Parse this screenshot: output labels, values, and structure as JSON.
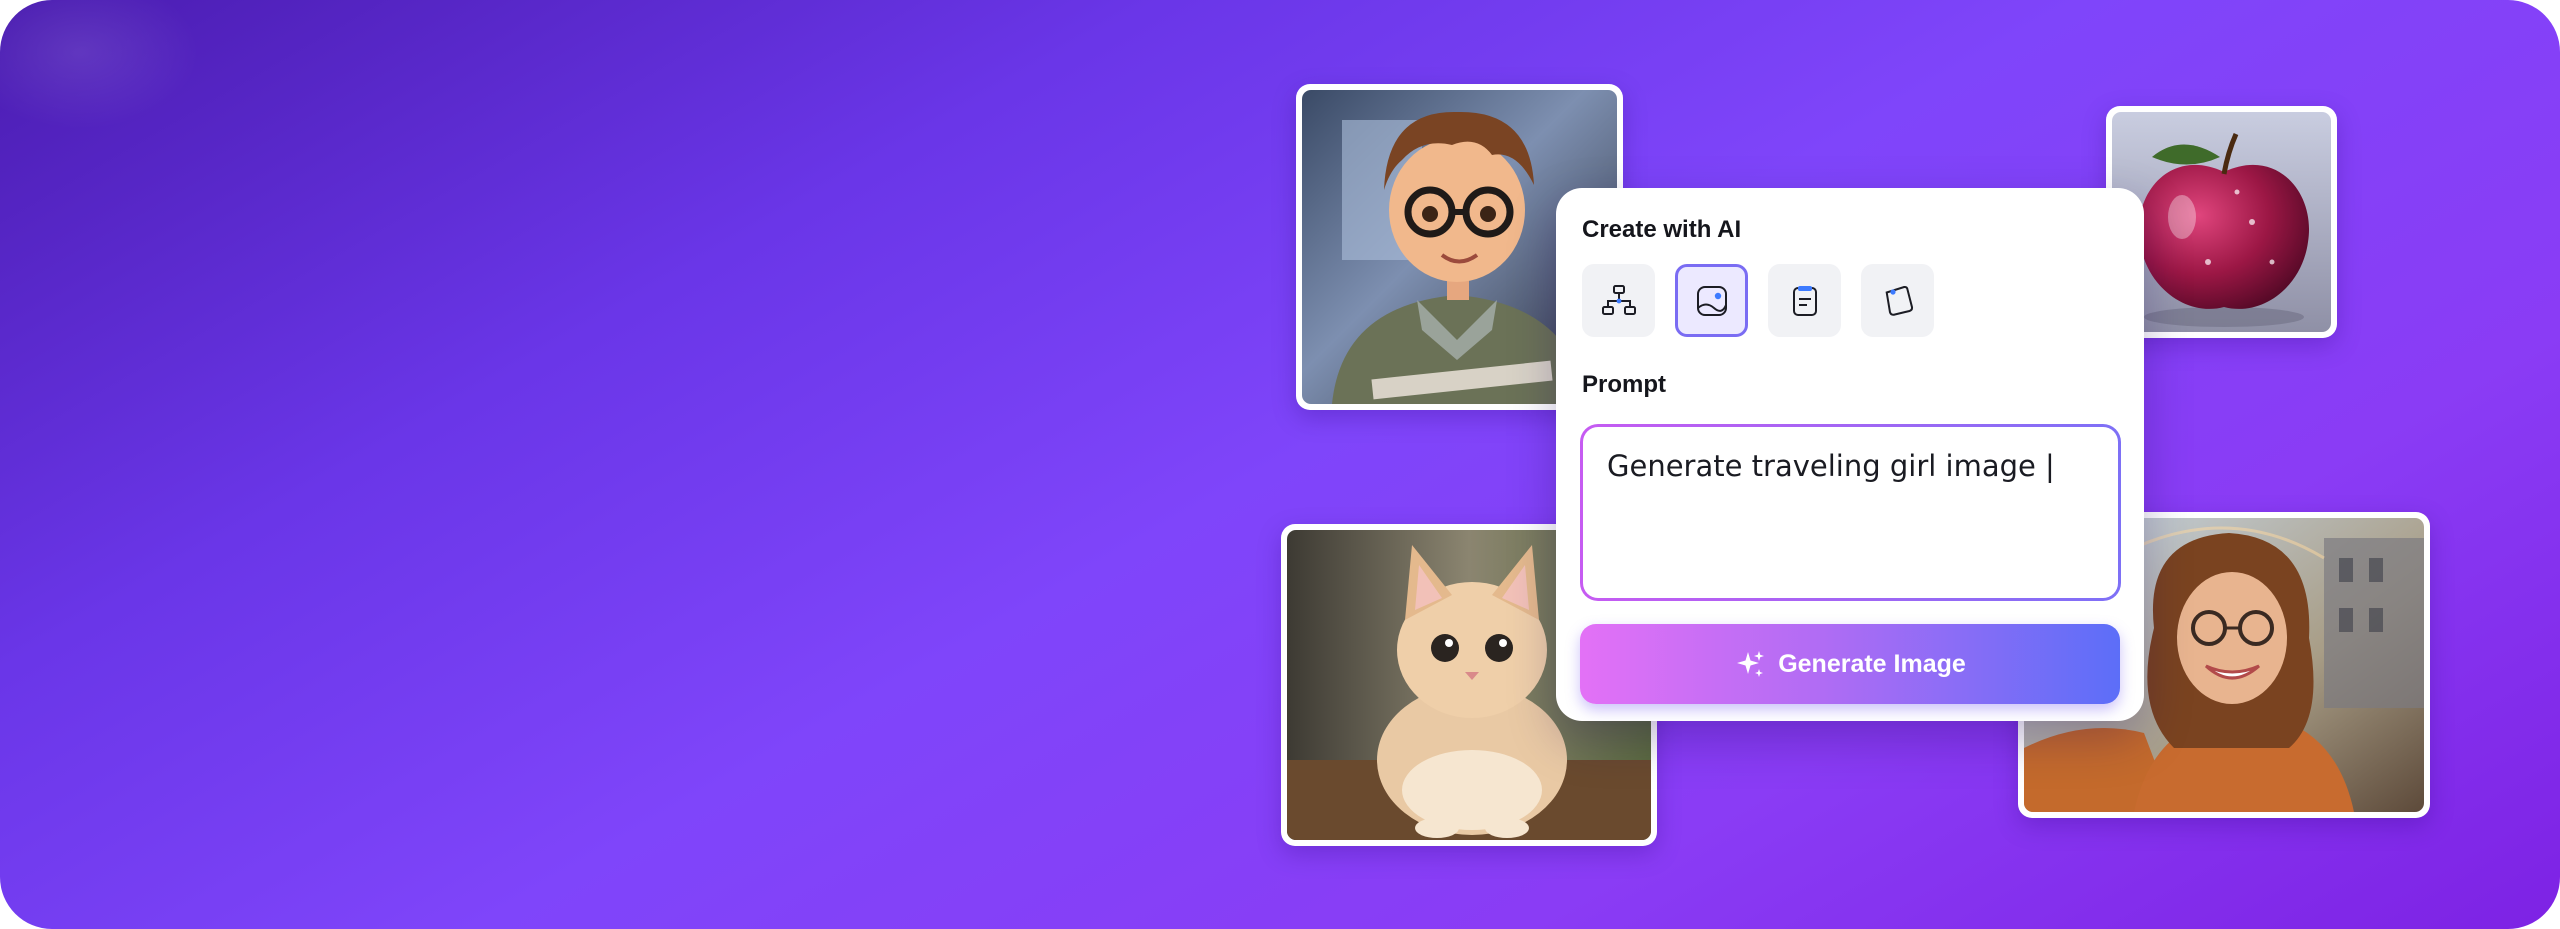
{
  "card": {
    "title": "Create with AI",
    "tools": [
      {
        "icon": "flowchart-icon",
        "active": false
      },
      {
        "icon": "image-icon",
        "active": true
      },
      {
        "icon": "document-icon",
        "active": false
      },
      {
        "icon": "sticky-note-icon",
        "active": false
      }
    ],
    "prompt_label": "Prompt",
    "prompt_value": "Generate traveling girl image |",
    "button_label": "Generate Image",
    "button_icon": "sparkle-icon"
  },
  "photos": [
    {
      "name": "cartoon-boy-photo",
      "subject": "cartoon-boy"
    },
    {
      "name": "apple-photo",
      "subject": "apple"
    },
    {
      "name": "kitten-photo",
      "subject": "kitten"
    },
    {
      "name": "smiling-girl-photo",
      "subject": "smiling-girl"
    }
  ],
  "colors": {
    "background_start": "#4a1cb0",
    "background_mid": "#7f45fa",
    "background_end": "#7d22e4",
    "active_tool_border": "#7a6cf3",
    "button_gradient_start": "#e371f6",
    "button_gradient_end": "#5c6ef8"
  }
}
